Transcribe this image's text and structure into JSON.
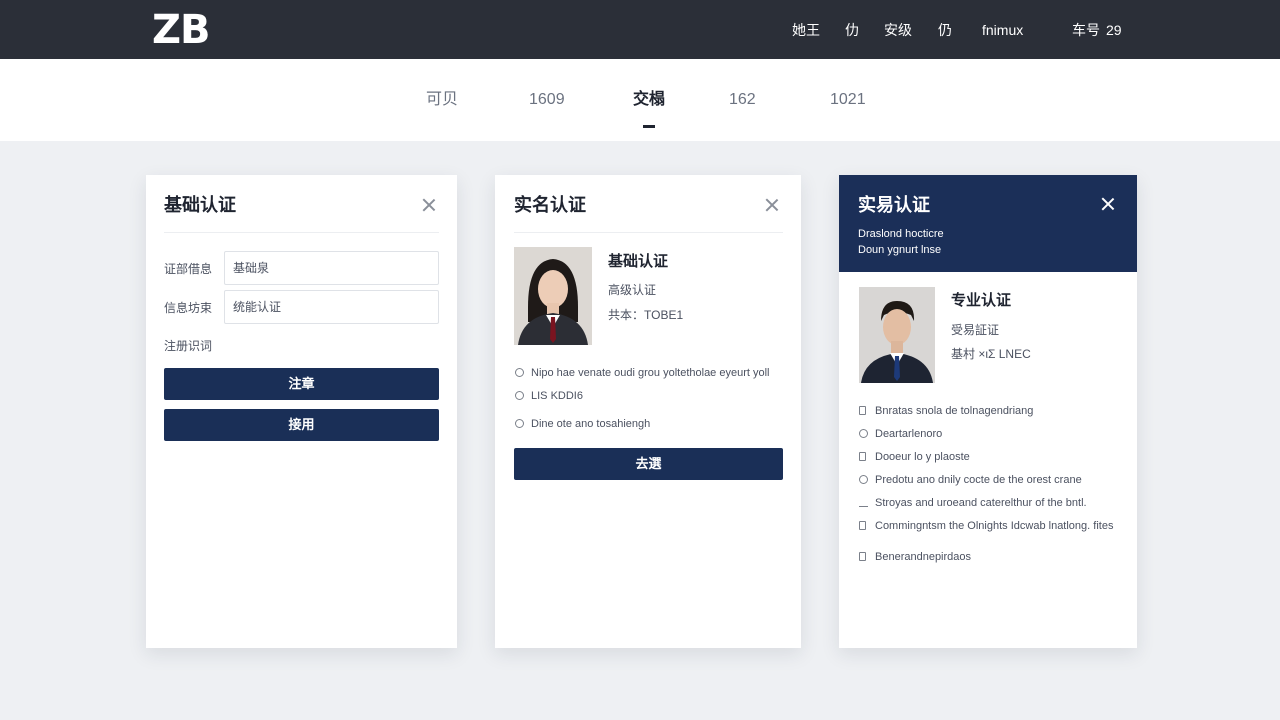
{
  "header": {
    "logo": "ZB",
    "nav": [
      "她王",
      "仂",
      "安级",
      "仍",
      "fnimux",
      "车号",
      "29"
    ]
  },
  "tabs": {
    "items": [
      "可贝",
      "1609",
      "交榻",
      "162",
      "1021"
    ],
    "active": "交榻"
  },
  "card_basic": {
    "title": "基础认证",
    "field1_label": "证部借息",
    "field1_value": "基础泉",
    "field2_label": "信息坊束",
    "field2_value": "统能认证",
    "note": "注册识词",
    "button1": "注章",
    "button2": "接用"
  },
  "card_realname": {
    "title": "实名认证",
    "name": "基础认证",
    "line1": "高级认证",
    "line2": "共本：TOBE1",
    "rows": [
      "Nipo hae venate oudi grou yoltetholae eyeurt yoll",
      "LIS KDDI6",
      "Dine ote ano tosahiengh"
    ],
    "button": "去選"
  },
  "card_pro": {
    "title": "实易认证",
    "sub1": "Draslond hocticre",
    "sub2": "Doun ygnurt lnse",
    "name": "专业认证",
    "line1": "受易証证",
    "line2": "基村 ×ιΣ LNEC",
    "rows": [
      "Bnratas snola de tolnagendriang",
      "Deartarlenoro",
      "Dooeur lo y plaoste",
      "Predotu ano dnily cocte de the orest crane",
      "Stroyas and uroeand caterelthur of the bntl.",
      "Commingntsm the Olnights Idcwab lnatlong. fites",
      "Benerandnepirdaos"
    ]
  },
  "colors": {
    "topbar": "#2b2f38",
    "accent": "#1a2f57",
    "background": "#eef0f3"
  }
}
